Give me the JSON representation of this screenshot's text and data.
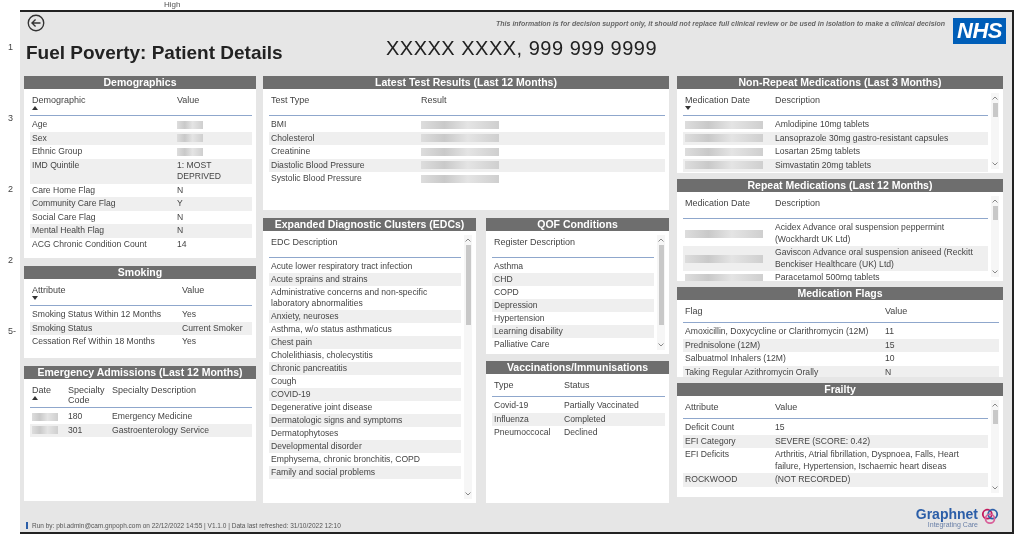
{
  "top_fragment": "High",
  "gutter_labels": [
    "1",
    "3",
    "2",
    "2",
    "5-"
  ],
  "header": {
    "title": "Fuel Poverty: Patient Details",
    "patient": "XXXXX XXXX, 999 999 9999",
    "disclaimer": "This information is for decision support only, it should not replace full clinical review or be used in isolation to make a clinical decision",
    "logo": "NHS"
  },
  "panels": {
    "demographics": {
      "title": "Demographics",
      "columns": [
        {
          "label": "Demographic",
          "sorted": true,
          "descending": false
        },
        {
          "label": "Value"
        }
      ],
      "rows": [
        [
          "Age",
          {
            "redacted": true
          }
        ],
        [
          "Sex",
          {
            "redacted": true
          }
        ],
        [
          "Ethnic Group",
          {
            "redacted": true
          }
        ],
        [
          "IMD Quintile",
          "1: MOST DEPRIVED"
        ],
        [
          "Care Home Flag",
          "N"
        ],
        [
          "Community Care Flag",
          "Y"
        ],
        [
          "Social Care Flag",
          "N"
        ],
        [
          "Mental Health Flag",
          "N"
        ],
        [
          "ACG Chronic Condition Count",
          "14"
        ]
      ]
    },
    "smoking": {
      "title": "Smoking",
      "columns": [
        {
          "label": "Attribute",
          "sorted": true,
          "descending": true
        },
        {
          "label": "Value"
        }
      ],
      "rows": [
        [
          "Smoking Status Within 12 Months",
          "Yes"
        ],
        [
          "Smoking Status",
          "Current Smoker"
        ],
        [
          "Cessation Ref Within 18 Months",
          "Yes"
        ]
      ]
    },
    "emergency_admissions": {
      "title": "Emergency Admissions (Last 12 Months)",
      "columns": [
        {
          "label": "Date",
          "sorted": true,
          "descending": false
        },
        {
          "label": "Specialty Code"
        },
        {
          "label": "Specialty Description"
        }
      ],
      "rows": [
        [
          {
            "redacted": true
          },
          "180",
          "Emergency Medicine"
        ],
        [
          {
            "redacted": true
          },
          "301",
          "Gastroenterology Service"
        ]
      ]
    },
    "latest_test_results": {
      "title": "Latest Test Results (Last 12 Months)",
      "columns": [
        {
          "label": "Test Type"
        },
        {
          "label": "Result"
        }
      ],
      "rows": [
        [
          "BMI",
          {
            "redacted": true
          }
        ],
        [
          "Cholesterol",
          {
            "redacted": true
          }
        ],
        [
          "Creatinine",
          {
            "redacted": true
          }
        ],
        [
          "Diastolic Blood Pressure",
          {
            "redacted": true
          }
        ],
        [
          "Systolic Blood Pressure",
          {
            "redacted": true
          }
        ]
      ]
    },
    "edc": {
      "title": "Expanded Diagnostic Clusters (EDCs)",
      "columns": [
        {
          "label": "EDC Description"
        }
      ],
      "rows": [
        [
          "Acute lower respiratory tract infection"
        ],
        [
          "Acute sprains and strains"
        ],
        [
          "Administrative concerns and non-specific laboratory abnormalities"
        ],
        [
          "Anxiety, neuroses"
        ],
        [
          "Asthma, w/o status asthmaticus"
        ],
        [
          "Chest pain"
        ],
        [
          "Cholelithiasis, cholecystitis"
        ],
        [
          "Chronic pancreatitis"
        ],
        [
          "Cough"
        ],
        [
          "COVID-19"
        ],
        [
          "Degenerative joint disease"
        ],
        [
          "Dermatologic signs and symptoms"
        ],
        [
          "Dermatophytoses"
        ],
        [
          "Developmental disorder"
        ],
        [
          "Emphysema, chronic bronchitis, COPD"
        ],
        [
          "Family and social problems"
        ]
      ]
    },
    "qof": {
      "title": "QOF Conditions",
      "columns": [
        {
          "label": "Register Description"
        }
      ],
      "rows": [
        [
          "Asthma"
        ],
        [
          "CHD"
        ],
        [
          "COPD"
        ],
        [
          "Depression"
        ],
        [
          "Hypertension"
        ],
        [
          "Learning disability"
        ],
        [
          "Palliative Care"
        ]
      ]
    },
    "vaccinations": {
      "title": "Vaccinations/Immunisations",
      "columns": [
        {
          "label": "Type"
        },
        {
          "label": "Status"
        }
      ],
      "rows": [
        [
          "Covid-19",
          "Partially Vaccinated"
        ],
        [
          "Influenza",
          "Completed"
        ],
        [
          "Pneumoccocal",
          "Declined"
        ]
      ]
    },
    "non_repeat_medications": {
      "title": "Non-Repeat Medications (Last 3 Months)",
      "columns": [
        {
          "label": "Medication Date",
          "sorted": true,
          "descending": true
        },
        {
          "label": "Description"
        }
      ],
      "rows": [
        [
          {
            "redacted": true
          },
          "Amlodipine 10mg tablets"
        ],
        [
          {
            "redacted": true
          },
          "Lansoprazole 30mg gastro-resistant capsules"
        ],
        [
          {
            "redacted": true
          },
          "Losartan 25mg tablets"
        ],
        [
          {
            "redacted": true
          },
          "Simvastatin 20mg tablets"
        ]
      ]
    },
    "repeat_medications": {
      "title": "Repeat Medications (Last 12 Months)",
      "columns": [
        {
          "label": "Medication Date"
        },
        {
          "label": "Description"
        }
      ],
      "rows": [
        [
          {
            "redacted": true
          },
          "Acidex Advance oral suspension peppermint (Wockhardt UK Ltd)"
        ],
        [
          {
            "redacted": true
          },
          "Gaviscon Advance oral suspension aniseed (Reckitt Benckiser Healthcare (UK) Ltd)"
        ],
        [
          {
            "redacted": true
          },
          "Paracetamol 500mg tablets"
        ]
      ]
    },
    "medication_flags": {
      "title": "Medication Flags",
      "columns": [
        {
          "label": "Flag"
        },
        {
          "label": "Value"
        }
      ],
      "rows": [
        [
          "Amoxicillin, Doxycycline or Clarithromycin (12M)",
          "11"
        ],
        [
          "Prednisolone (12M)",
          "15"
        ],
        [
          "Salbuatmol Inhalers (12M)",
          "10"
        ],
        [
          "Taking Regular Azithromycin Orally",
          "N"
        ]
      ]
    },
    "frailty": {
      "title": "Frailty",
      "columns": [
        {
          "label": "Attribute"
        },
        {
          "label": "Value"
        }
      ],
      "rows": [
        [
          "Deficit Count",
          "15"
        ],
        [
          "EFI Category",
          "SEVERE (SCORE: 0.42)"
        ],
        [
          "EFI Deficits",
          "Arthritis, Atrial fibrillation, Dyspnoea, Falls, Heart failure, Hypertension, Ischaemic heart diseas"
        ],
        [
          "ROCKWOOD",
          "(NOT RECORDED)"
        ]
      ]
    }
  },
  "footer": {
    "run_info": "Run by: pbi.admin@cam.gnpoph.com on 22/12/2022 14:55 | V1.1.0 | Data last refreshed: 31/10/2022 12:10",
    "brand": "Graphnet",
    "tagline": "Integrating Care"
  }
}
